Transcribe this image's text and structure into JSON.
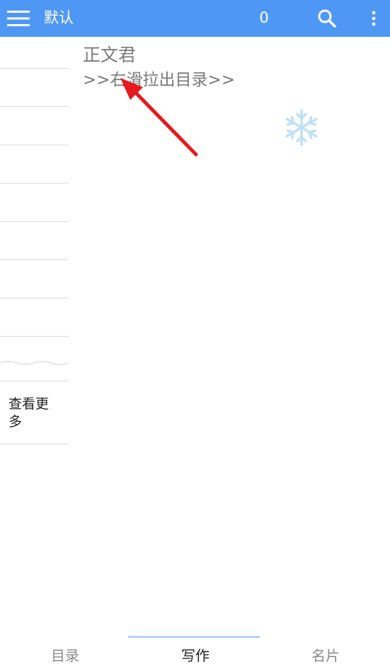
{
  "topbar": {
    "title": "默认",
    "count": "0",
    "background": "#4f97f5",
    "icons": [
      "menu-icon",
      "search-icon",
      "more-vert-icon"
    ]
  },
  "sidebar": {
    "see_more_label": "查看更多"
  },
  "content": {
    "title": "正文君",
    "hint": ">>右滑拉出目录>>",
    "decorations": [
      "snowflake-icon",
      "red-arrow-annotation"
    ]
  },
  "tabs": [
    {
      "label": "目录",
      "active": false
    },
    {
      "label": "写作",
      "active": true
    },
    {
      "label": "名片",
      "active": false
    }
  ],
  "colors": {
    "accent": "#4f97f5",
    "indicator": "#b8cff8",
    "annotation": "#e8191c"
  }
}
